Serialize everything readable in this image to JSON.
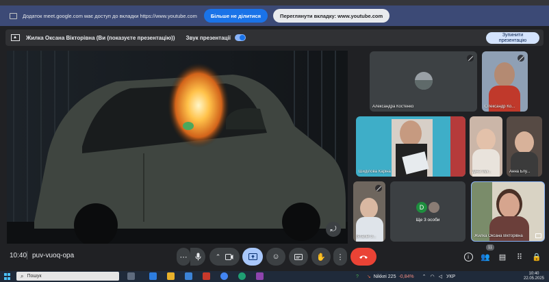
{
  "share_bar": {
    "text": "Додаток meet.google.com має доступ до вкладки https://www.youtube.com",
    "stop_sharing_label": "Більше не ділитися",
    "switch_tab_label": "Переглянути вкладку: www.youtube.com"
  },
  "presenting_bar": {
    "title": "Жилка Оксана Вікторівна (Ви (показуєте презентацію))",
    "audio_label": "Звук презентації",
    "stop_presenting_line1": "Зупинити",
    "stop_presenting_line2": "презентацію"
  },
  "participants": [
    {
      "name": "Александра Костенко"
    },
    {
      "name": "Олександр Ко..."
    },
    {
      "name": "Шиділова Каріна"
    },
    {
      "name": "Діна Лук..."
    },
    {
      "name": "Анна Блу..."
    },
    {
      "name": "Віталій З..."
    },
    {
      "name": "Ще 3 особи",
      "avatar_letter": "D"
    },
    {
      "name": "Жилка Оксана Вікторівна"
    }
  ],
  "bottom_bar": {
    "time": "10:40",
    "meeting_code": "puv-vuoq-opa",
    "participant_count": "11"
  },
  "taskbar": {
    "search_placeholder": "Пошук",
    "stock_name": "Nikkei 225",
    "stock_change": "-0,84%",
    "language": "УКР",
    "clock_time": "10:40",
    "clock_date": "22.05.2025"
  },
  "colors": {
    "meet_bg": "#202124",
    "share_bar_bg": "#3c4a76",
    "accent_blue": "#1a73e8",
    "end_call_red": "#ea4335",
    "present_active": "#a8c7fa"
  }
}
